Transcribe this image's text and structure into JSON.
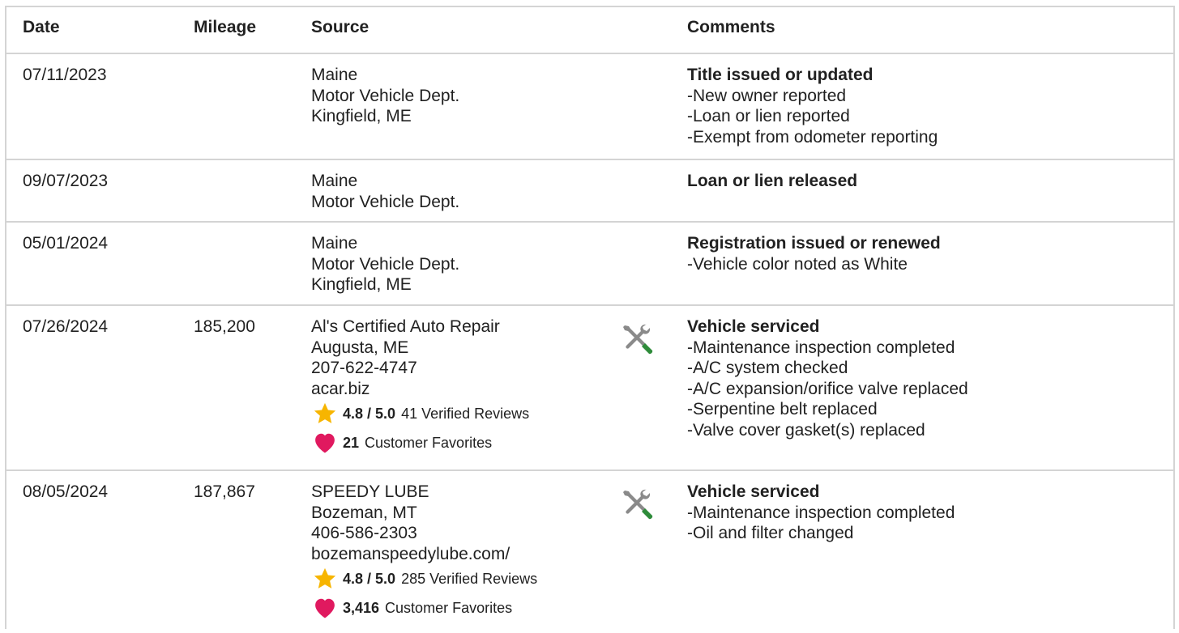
{
  "headers": {
    "date": "Date",
    "mileage": "Mileage",
    "source": "Source",
    "comments": "Comments"
  },
  "rows": [
    {
      "date": "07/11/2023",
      "mileage": "",
      "source": [
        "Maine",
        "Motor Vehicle Dept.",
        "Kingfield, ME"
      ],
      "comment_title": "Title issued or updated",
      "comment_items": [
        "New owner reported",
        "Loan or lien reported",
        "Exempt from odometer reporting"
      ]
    },
    {
      "date": "09/07/2023",
      "mileage": "",
      "source": [
        "Maine",
        "Motor Vehicle Dept."
      ],
      "comment_title": "Loan or lien released",
      "comment_items": []
    },
    {
      "date": "05/01/2024",
      "mileage": "",
      "source": [
        "Maine",
        "Motor Vehicle Dept.",
        "Kingfield, ME"
      ],
      "comment_title": "Registration issued or renewed",
      "comment_items": [
        "Vehicle color noted as White"
      ]
    },
    {
      "date": "07/26/2024",
      "mileage": "185,200",
      "source": [
        "Al's Certified Auto Repair",
        "Augusta, ME",
        "207-622-4747",
        "acar.biz"
      ],
      "rating": "4.8 / 5.0",
      "reviews": "41 Verified Reviews",
      "favorites_count": "21",
      "favorites_label": "Customer Favorites",
      "icon": "service-wrench-screwdriver-icon",
      "comment_title": "Vehicle serviced",
      "comment_items": [
        "Maintenance inspection completed",
        "A/C system checked",
        "A/C expansion/orifice valve replaced",
        "Serpentine belt replaced",
        "Valve cover gasket(s) replaced"
      ]
    },
    {
      "date": "08/05/2024",
      "mileage": "187,867",
      "source": [
        "SPEEDY LUBE",
        "Bozeman, MT",
        "406-586-2303",
        "bozemanspeedylube.com/"
      ],
      "rating": "4.8 / 5.0",
      "reviews": "285 Verified Reviews",
      "favorites_count": "3,416",
      "favorites_label": "Customer Favorites",
      "icon": "service-wrench-screwdriver-icon",
      "comment_title": "Vehicle serviced",
      "comment_items": [
        "Maintenance inspection completed",
        "Oil and filter changed"
      ]
    }
  ],
  "colors": {
    "border": "#d4d4d4",
    "text": "#212121",
    "star": "#f7b500",
    "heart": "#e0195f",
    "tool_gray": "#8a8a8a",
    "tool_green": "#2e8b3a"
  }
}
